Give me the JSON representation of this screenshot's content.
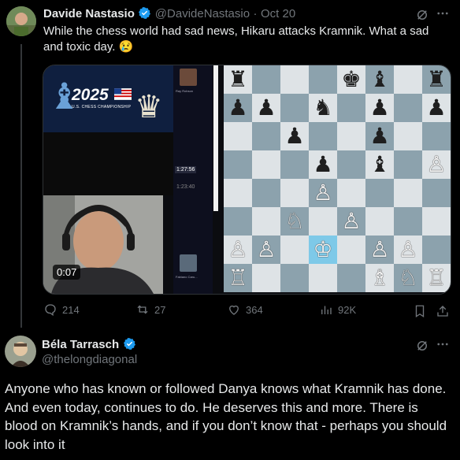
{
  "tweet1": {
    "author_name": "Davide Nastasio",
    "handle": "@DavideNastasio",
    "separator": "·",
    "date": "Oct 20",
    "text": "While the chess world had sad news, Hikaru attacks Kramnik. What a sad and toxic day. 😢",
    "media": {
      "banner_year": "2025",
      "banner_subtitle": "U.S. CHESS CHAMPIONSHIP",
      "video_time": "0:07",
      "clock_top": "1:27:56",
      "clock_bottom": "1:23:40",
      "player_top": "Ray Robson",
      "player_bottom": "Fabiano Caru..."
    },
    "actions": {
      "replies": "214",
      "reposts": "27",
      "likes": "364",
      "views": "92K"
    }
  },
  "tweet2": {
    "author_name": "Béla Tarrasch",
    "handle": "@thelongdiagonal",
    "text": "Anyone who has known or followed Danya knows what Kramnik has done. And even today, continues to do. He deserves this and more. There is blood on Kramnik’s hands, and if you don’t know that - perhaps you should look into it"
  },
  "icons": {
    "verified": "verified-badge-icon",
    "grok": "grok-icon",
    "more": "more-icon"
  },
  "colors": {
    "background": "#000000",
    "text": "#e7e9ea",
    "muted": "#71767b",
    "verified": "#1d9bf0",
    "board_light": "#dee3e6",
    "board_dark": "#8ca2ad",
    "board_highlight": "#7ec9e8"
  }
}
